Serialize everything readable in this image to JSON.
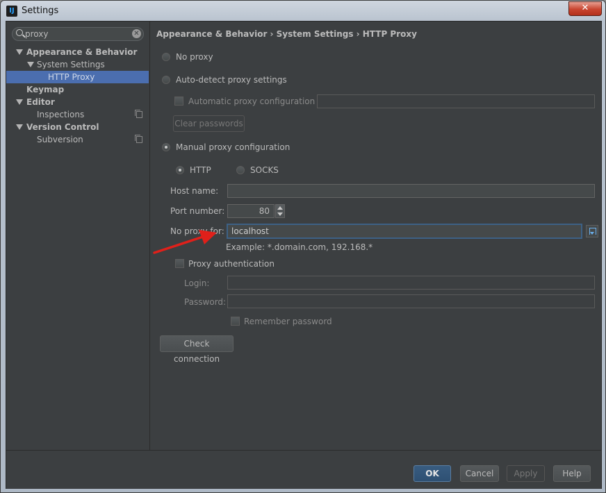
{
  "window": {
    "title": "Settings",
    "app_icon_text": "IJ",
    "close_label": "✕"
  },
  "search": {
    "value": "proxy",
    "clear_label": "✕"
  },
  "tree": {
    "appearance": "Appearance & Behavior",
    "system_settings": "System Settings",
    "http_proxy": "HTTP Proxy",
    "keymap": "Keymap",
    "editor": "Editor",
    "inspections": "Inspections",
    "version_control": "Version Control",
    "subversion": "Subversion"
  },
  "breadcrumb": "Appearance & Behavior  ›  System Settings  ›  HTTP Proxy",
  "proxy": {
    "no_proxy": "No proxy",
    "auto_detect": "Auto-detect proxy settings",
    "auto_config_url": "Automatic proxy configuration URL:",
    "clear_passwords": "Clear passwords",
    "manual": "Manual proxy configuration",
    "selected_mode": "manual",
    "http": "HTTP",
    "socks": "SOCKS",
    "selected_type": "HTTP",
    "host_name_label": "Host name:",
    "host_name_value": "",
    "port_label": "Port number:",
    "port_value": "80",
    "no_proxy_for_label": "No proxy for:",
    "no_proxy_for_value": "localhost",
    "example": "Example: *.domain.com, 192.168.*",
    "proxy_auth": "Proxy authentication",
    "login_label": "Login:",
    "password_label": "Password:",
    "remember_password": "Remember password",
    "check_connection": "Check connection"
  },
  "footer": {
    "ok": "OK",
    "cancel": "Cancel",
    "apply": "Apply",
    "help": "Help"
  },
  "colors": {
    "background": "#3c3f41",
    "selection": "#4b6eaf",
    "annotation_arrow": "#e0201a",
    "default_button": "#365880"
  }
}
